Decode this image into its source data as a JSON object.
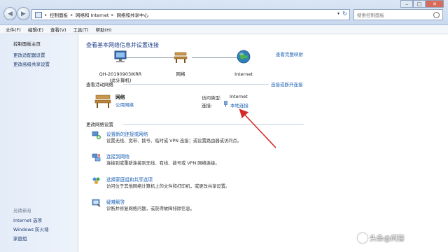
{
  "nav": {
    "breadcrumbs": [
      "控制面板",
      "网络和 Internet",
      "网络和共享中心"
    ],
    "search_placeholder": "搜索控制面板",
    "back_glyph": "◀",
    "fwd_glyph": "▶"
  },
  "menu": [
    "文件(F)",
    "编辑(E)",
    "查看(V)",
    "工具(T)",
    "帮助(H)"
  ],
  "sidebar": {
    "home": "控制面板主页",
    "links": [
      "更改适配器设置",
      "更改高级共享设置"
    ],
    "see_also_title": "另请参阅",
    "see_also": [
      "Internet 选项",
      "Windows 防火墙",
      "家庭组"
    ]
  },
  "main": {
    "title": "查看基本网络信息并设置连接",
    "full_map": "查看完整映射",
    "map": {
      "computer": "QH-20190903IKRR",
      "computer_sub": "(此计算机)",
      "network": "网络",
      "internet": "Internet"
    },
    "active_label": "查看活动网络",
    "connect_link": "连接或断开连接",
    "active": {
      "name": "网络",
      "type": "公用网络",
      "access_label": "访问类型:",
      "access_value": "Internet",
      "conn_label": "连接:",
      "conn_value": "本地连接"
    },
    "change_label": "更改网络设置",
    "tasks": [
      {
        "title": "设置新的连接或网络",
        "desc": "设置无线、宽带、拨号、临时或 VPN 连接；或设置路由器或访问点。"
      },
      {
        "title": "连接到网络",
        "desc": "连接到或重新连接到无线、有线、拨号或 VPN 网络连接。"
      },
      {
        "title": "选择家庭组和共享选项",
        "desc": "访问位于其他网络计算机上的文件和打印机，或更改共享设置。"
      },
      {
        "title": "疑难解答",
        "desc": "诊断并修复网络问题，或获得故障排除信息。"
      }
    ]
  },
  "watermark": "头条@问答",
  "colors": {
    "link": "#1a5fb4",
    "title": "#1e3f8a",
    "arrow": "#d42a2a"
  }
}
